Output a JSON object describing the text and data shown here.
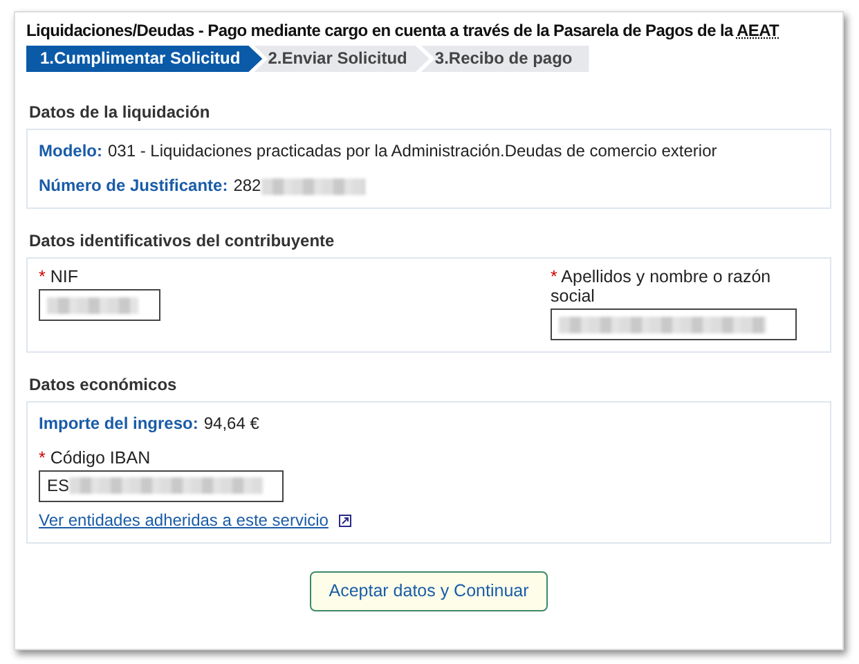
{
  "title": {
    "text": "Liquidaciones/Deudas - Pago mediante cargo en cuenta a través de la Pasarela de Pagos de la ",
    "abbr": "AEAT"
  },
  "steps": [
    {
      "label": "1.Cumplimentar Solicitud",
      "selected": true
    },
    {
      "label": "2.Enviar Solicitud",
      "selected": false
    },
    {
      "label": "3.Recibo de pago",
      "selected": false
    }
  ],
  "liquidacion": {
    "heading": "Datos de la liquidación",
    "fields": [
      {
        "label": "Modelo:",
        "value": "031 - Liquidaciones practicadas por la Administración.Deudas de comercio exterior"
      },
      {
        "label": "Número de Justificante:",
        "value": "282",
        "redacted": true
      }
    ]
  },
  "contribuyente": {
    "heading": "Datos identificativos del contribuyente",
    "inputs": [
      {
        "required_mark": "*",
        "label": "NIF",
        "redacted": true
      },
      {
        "required_mark": "*",
        "label": "Apellidos y nombre o razón social",
        "redacted": true
      }
    ]
  },
  "economicos": {
    "heading": "Datos económicos",
    "amount": {
      "label": "Importe del ingreso:",
      "value": "94,64 €"
    },
    "iban": {
      "required_mark": "*",
      "label": "Código IBAN",
      "value": "ES",
      "redacted": true
    },
    "link": "Ver entidades adheridas a este servicio"
  },
  "submit_button": "Aceptar datos y Continuar"
}
